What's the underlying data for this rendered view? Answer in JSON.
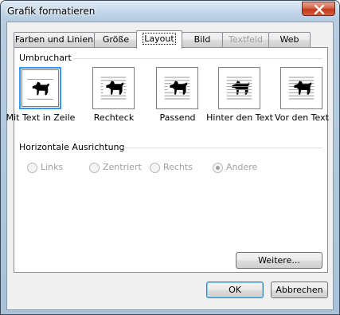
{
  "window": {
    "title": "Grafik formatieren",
    "close_icon": "close-icon"
  },
  "tabs": [
    {
      "label": "Farben und Linien",
      "active": false,
      "disabled": false
    },
    {
      "label": "Größe",
      "active": false,
      "disabled": false
    },
    {
      "label": "Layout",
      "active": true,
      "disabled": false
    },
    {
      "label": "Bild",
      "active": false,
      "disabled": false
    },
    {
      "label": "Textfeld",
      "active": false,
      "disabled": true
    },
    {
      "label": "Web",
      "active": false,
      "disabled": false
    }
  ],
  "wrapping": {
    "group_label": "Umbruchart",
    "options": [
      {
        "label": "Mit Text in Zeile",
        "icon": "inline-with-text-icon",
        "selected": true
      },
      {
        "label": "Rechteck",
        "icon": "square-wrap-icon",
        "selected": false
      },
      {
        "label": "Passend",
        "icon": "tight-wrap-icon",
        "selected": false
      },
      {
        "label": "Hinter den Text",
        "icon": "behind-text-icon",
        "selected": false
      },
      {
        "label": "Vor den Text",
        "icon": "in-front-of-text-icon",
        "selected": false
      }
    ]
  },
  "alignment": {
    "group_label": "Horizontale Ausrichtung",
    "options": [
      {
        "label": "Links",
        "checked": false,
        "enabled": false
      },
      {
        "label": "Zentriert",
        "checked": false,
        "enabled": false
      },
      {
        "label": "Rechts",
        "checked": false,
        "enabled": false
      },
      {
        "label": "Andere",
        "checked": true,
        "enabled": false
      }
    ]
  },
  "buttons": {
    "more": "Weitere...",
    "ok": "OK",
    "cancel": "Abbrechen"
  },
  "colors": {
    "selection_border": "#3399ff",
    "disabled_text": "#a0a0a0"
  }
}
